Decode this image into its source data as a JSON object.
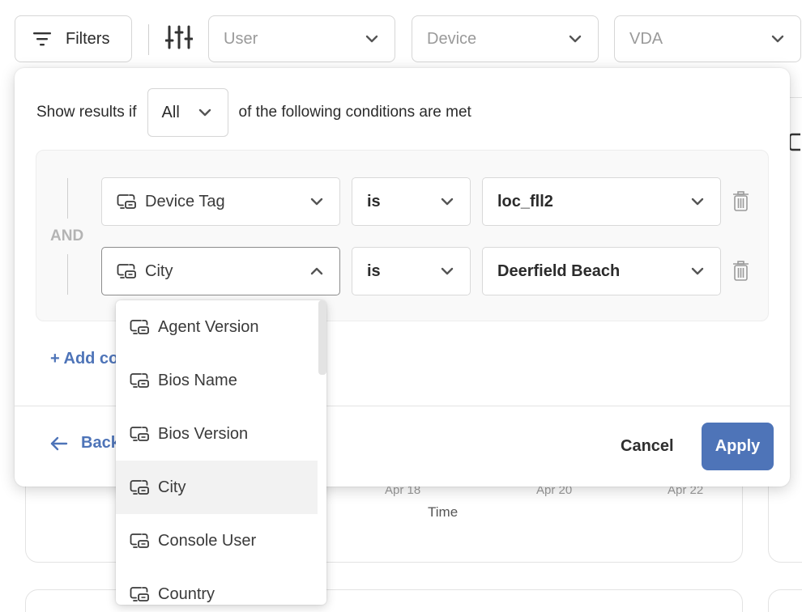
{
  "topbar": {
    "filters_label": "Filters",
    "user_placeholder": "User",
    "device_placeholder": "Device",
    "vda_placeholder": "VDA"
  },
  "background": {
    "x_ticks": [
      "Apr 18",
      "Apr 20",
      "Apr 22"
    ],
    "x_title": "Time"
  },
  "modal": {
    "show_results_prefix": "Show results if",
    "match_mode": "All",
    "show_results_suffix": "of the following conditions are met",
    "group_operator": "AND",
    "conditions": [
      {
        "field": "Device Tag",
        "operator": "is",
        "value": "loc_fll2"
      },
      {
        "field": "City",
        "operator": "is",
        "value": "Deerfield Beach"
      }
    ],
    "add_condition_label": "+ Add co",
    "back_label": "Back",
    "cancel_label": "Cancel",
    "apply_label": "Apply"
  },
  "dropdown": {
    "items": [
      "Agent Version",
      "Bios Name",
      "Bios Version",
      "City",
      "Console User",
      "Country"
    ],
    "selected": "City"
  },
  "colors": {
    "accent": "#4e74b8",
    "selected_row": "#f2f2f2"
  }
}
